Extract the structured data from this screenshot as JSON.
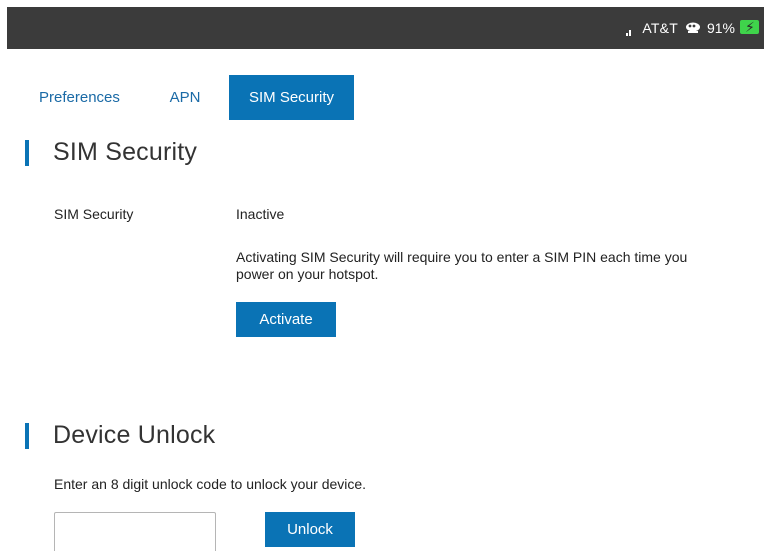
{
  "status_bar": {
    "carrier": "AT&T",
    "battery_percent": "91%",
    "icons": [
      "signal-icon",
      "network-icon",
      "battery-charging-icon"
    ],
    "battery_color": "#3fd34b"
  },
  "tabs": [
    {
      "label": "Preferences",
      "active": false
    },
    {
      "label": "APN",
      "active": false
    },
    {
      "label": "SIM Security",
      "active": true
    }
  ],
  "sim_security": {
    "heading": "SIM Security",
    "field_label": "SIM Security",
    "status": "Inactive",
    "note": "Activating SIM Security will require you to enter a SIM PIN each time you power on your hotspot.",
    "activate_label": "Activate"
  },
  "device_unlock": {
    "heading": "Device Unlock",
    "instructions": "Enter an 8 digit unlock code to unlock your device.",
    "code_value": "",
    "code_placeholder": "",
    "unlock_label": "Unlock"
  },
  "colors": {
    "accent": "#0a73b5",
    "status_bar_bg": "#3b3b3b"
  }
}
